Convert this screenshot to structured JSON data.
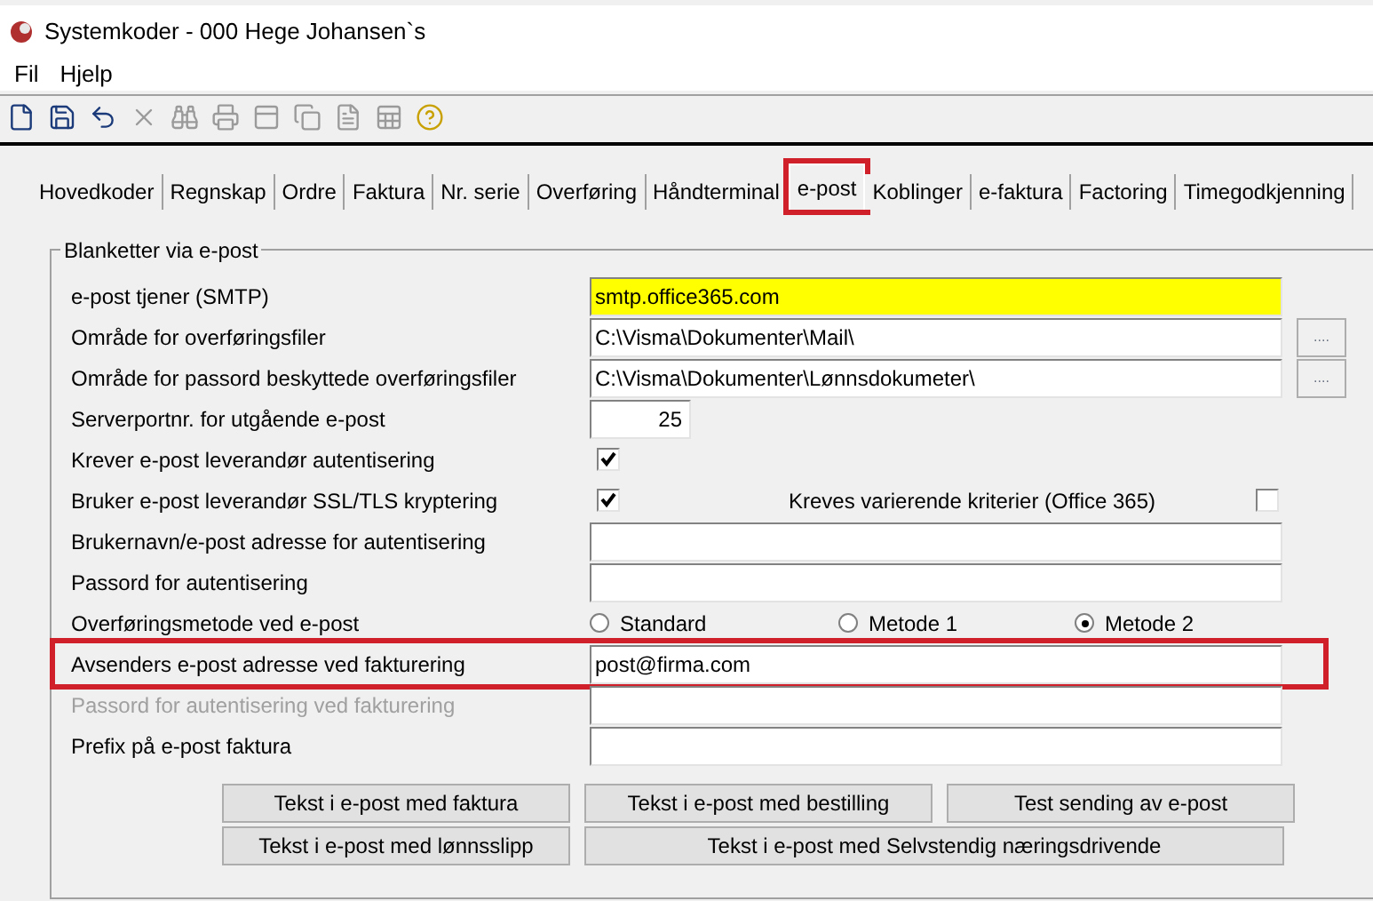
{
  "window": {
    "title": "Systemkoder - 000 Hege Johansen`s"
  },
  "menu": [
    "Fil",
    "Hjelp"
  ],
  "toolbar": [
    {
      "kind": "new",
      "disabled": false
    },
    {
      "kind": "save",
      "disabled": false
    },
    {
      "kind": "undo",
      "disabled": false
    },
    {
      "kind": "delete",
      "disabled": true
    },
    {
      "kind": "find",
      "disabled": true
    },
    {
      "kind": "print",
      "disabled": true
    },
    {
      "kind": "form",
      "disabled": true
    },
    {
      "kind": "copy",
      "disabled": true
    },
    {
      "kind": "word",
      "disabled": true
    },
    {
      "kind": "excel",
      "disabled": true
    },
    {
      "kind": "help",
      "disabled": false
    }
  ],
  "tabs": [
    {
      "label": "Hovedkoder",
      "selected": false,
      "highlighted": false
    },
    {
      "label": "Regnskap",
      "selected": false,
      "highlighted": false
    },
    {
      "label": "Ordre",
      "selected": false,
      "highlighted": false
    },
    {
      "label": "Faktura",
      "selected": false,
      "highlighted": false
    },
    {
      "label": "Nr. serie",
      "selected": false,
      "highlighted": false
    },
    {
      "label": "Overføring",
      "selected": false,
      "highlighted": false
    },
    {
      "label": "Håndterminal",
      "selected": false,
      "highlighted": false
    },
    {
      "label": "e-post",
      "selected": true,
      "highlighted": true
    },
    {
      "label": "Koblinger",
      "selected": false,
      "highlighted": false
    },
    {
      "label": "e-faktura",
      "selected": false,
      "highlighted": false
    },
    {
      "label": "Factoring",
      "selected": false,
      "highlighted": false
    },
    {
      "label": "Timegodkjenning",
      "selected": false,
      "highlighted": false
    }
  ],
  "group": {
    "title": "Blanketter via e-post",
    "rows": [
      {
        "kind": "field",
        "label": "e-post tjener (SMTP)",
        "value": "smtp.office365.com",
        "focused": true,
        "disabled": false,
        "highlighted": false
      },
      {
        "kind": "field",
        "label": "Område for overføringsfiler",
        "value": "C:\\Visma\\Dokumenter\\Mail\\",
        "browse": "....",
        "focused": false,
        "disabled": false,
        "highlighted": false
      },
      {
        "kind": "field",
        "label": "Område for passord beskyttede overføringsfiler",
        "value": "C:\\Visma\\Dokumenter\\Lønnsdokumeter\\",
        "browse": "....",
        "focused": false,
        "disabled": false,
        "highlighted": false
      },
      {
        "kind": "number",
        "label": "Serverportnr. for utgående e-post",
        "value": "25"
      },
      {
        "kind": "checkbox",
        "label": "Krever e-post leverandør autentisering",
        "checked": true
      },
      {
        "kind": "checkbox",
        "label": "Bruker e-post leverandør SSL/TLS kryptering",
        "checked": true,
        "extra_label": "Kreves varierende kriterier (Office 365)",
        "extra_checked": false
      },
      {
        "kind": "field",
        "label": "Brukernavn/e-post adresse for autentisering",
        "focused": false,
        "disabled": false,
        "highlighted": false
      },
      {
        "kind": "field",
        "label": "Passord for autentisering",
        "focused": false,
        "disabled": false,
        "highlighted": false
      },
      {
        "kind": "radio",
        "label": "Overføringsmetode ved e-post",
        "options": [
          {
            "label": "Standard",
            "selected": false
          },
          {
            "label": "Metode 1",
            "selected": false
          },
          {
            "label": "Metode 2",
            "selected": true
          }
        ]
      },
      {
        "kind": "field",
        "label": "Avsenders e-post adresse ved fakturering",
        "value": "post@firma.com",
        "focused": false,
        "disabled": false,
        "highlighted": true
      },
      {
        "kind": "field",
        "label": "Passord for autentisering ved fakturering",
        "focused": false,
        "disabled": true,
        "highlighted": false
      },
      {
        "kind": "field",
        "label": "Prefix på e-post faktura",
        "focused": false,
        "disabled": false,
        "highlighted": false
      }
    ]
  },
  "buttons": [
    [
      "Tekst i e-post med faktura",
      "Tekst i e-post med bestilling",
      "Test sending av e-post"
    ],
    [
      "Tekst i e-post med lønnsslipp",
      "Tekst i e-post med Selvstendig næringsdrivende"
    ]
  ]
}
